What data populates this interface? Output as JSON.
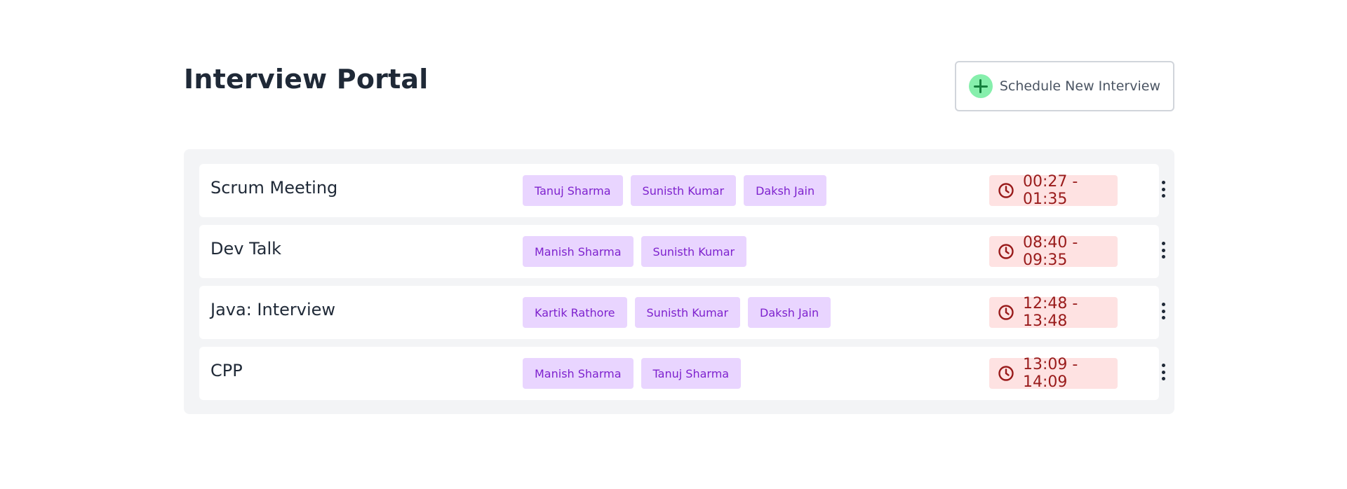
{
  "header": {
    "title": "Interview Portal",
    "schedule_button_label": "Schedule New Interview",
    "schedule_button_icon": "plus-circle-icon"
  },
  "meetings": [
    {
      "title": "Scrum Meeting",
      "participants": [
        "Tanuj Sharma",
        "Sunisth Kumar",
        "Daksh Jain"
      ],
      "time": "00:27 - 01:35"
    },
    {
      "title": "Dev Talk",
      "participants": [
        "Manish Sharma",
        "Sunisth Kumar"
      ],
      "time": "08:40 - 09:35"
    },
    {
      "title": "Java: Interview",
      "participants": [
        "Kartik Rathore",
        "Sunisth Kumar",
        "Daksh Jain"
      ],
      "time": "12:48 - 13:48"
    },
    {
      "title": "CPP",
      "participants": [
        "Manish Sharma",
        "Tanuj Sharma"
      ],
      "time": "13:09 - 14:09"
    }
  ],
  "colors": {
    "tag_bg": "#e9d5ff",
    "tag_text": "#7e22ce",
    "time_bg": "#fee2e2",
    "time_text": "#991b1b",
    "plus_bg": "#86efac",
    "plus_fg": "#15803d"
  },
  "icons": {
    "time": "clock-icon",
    "menu": "more-vertical-icon"
  }
}
